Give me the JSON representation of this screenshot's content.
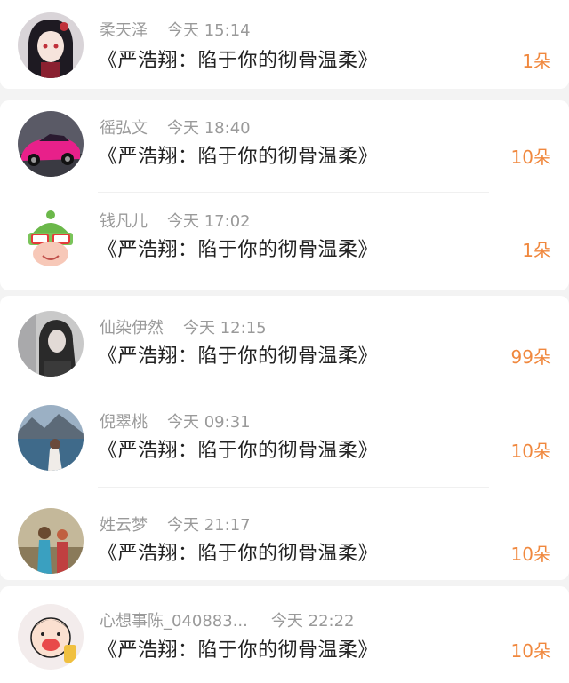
{
  "comments": [
    {
      "user": "柔天泽",
      "time": "今天 15:14",
      "title": "《严浩翔：陷于你的彻骨温柔》",
      "count": "1朵",
      "avatar_icon": "anime-girl-avatar"
    },
    {
      "user": "徭弘文",
      "time": "今天 18:40",
      "title": "《严浩翔：陷于你的彻骨温柔》",
      "count": "10朵",
      "avatar_icon": "pink-sports-car-avatar"
    },
    {
      "user": "钱凡儿",
      "time": "今天 17:02",
      "title": "《严浩翔：陷于你的彻骨温柔》",
      "count": "1朵",
      "avatar_icon": "cartoon-frog-avatar"
    },
    {
      "user": "仙染伊然",
      "time": "今天 12:15",
      "title": "《严浩翔：陷于你的彻骨温柔》",
      "count": "99朵",
      "avatar_icon": "grey-portrait-avatar"
    },
    {
      "user": "倪翠桃",
      "time": "今天 09:31",
      "title": "《严浩翔：陷于你的彻骨温柔》",
      "count": "10朵",
      "avatar_icon": "lake-mountain-avatar"
    },
    {
      "user": "姓云梦",
      "time": "今天 21:17",
      "title": "《严浩翔：陷于你的彻骨温柔》",
      "count": "10朵",
      "avatar_icon": "outdoor-kids-avatar"
    },
    {
      "user": "心想事陈_040883...",
      "time": "今天 22:22",
      "title": "《严浩翔：陷于你的彻骨温柔》",
      "count": "10朵",
      "avatar_icon": "cartoon-boy-avatar"
    }
  ],
  "colors": {
    "count": "#f0883e",
    "username": "#9a9a9a",
    "title": "#222222",
    "background": "#f3f3f3",
    "card": "#ffffff"
  }
}
